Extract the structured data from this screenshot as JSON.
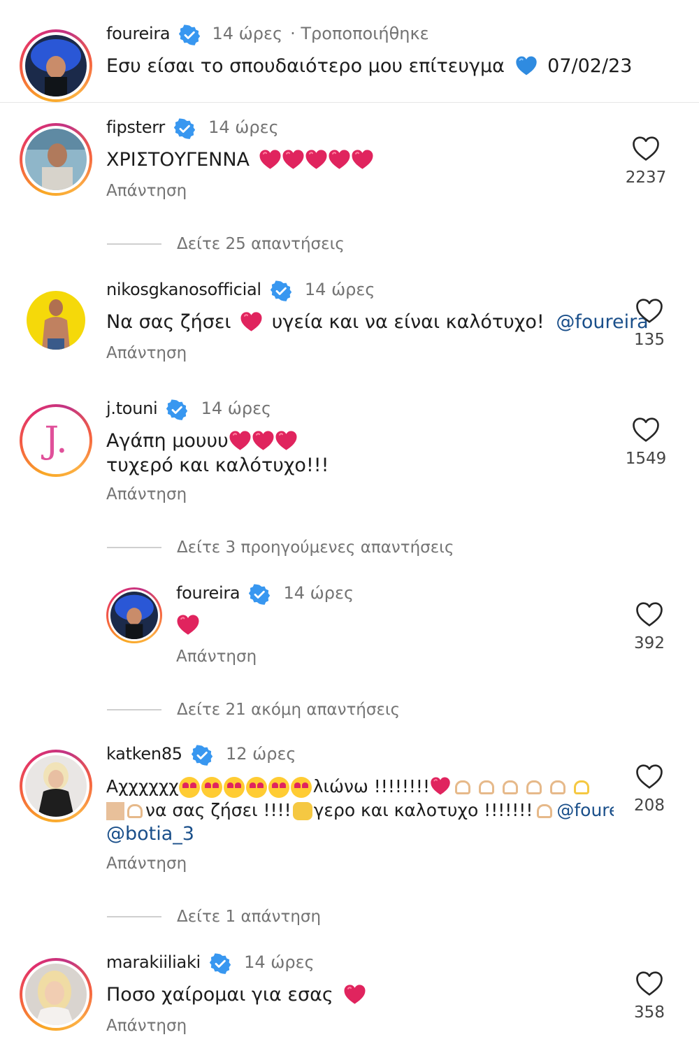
{
  "caption": {
    "username": "foureira",
    "time": "14 ώρες",
    "edited": "· Τροποποιήθηκε",
    "text": "Εσυ είσαι το σπουδαιότερο μου επίτευγμα",
    "date": "07/02/23"
  },
  "comments": [
    {
      "username": "fipsterr",
      "time": "14 ώρες",
      "text": "ΧΡΙΣΤΟΥΓΕΝΝΑ",
      "reply": "Απάντηση",
      "likes": "2237"
    },
    {
      "username": "nikosgkanosofficial",
      "time": "14 ώρες",
      "text_a": "Να σας ζήσει",
      "text_b": "υγεία και να είναι καλότυχο!",
      "mention": "@foureira",
      "reply": "Απάντηση",
      "likes": "135"
    },
    {
      "username": "j.touni",
      "time": "14 ώρες",
      "line1": "Αγάπη μουυυ",
      "line2": "τυχερό και καλότυχο!!!",
      "reply": "Απάντηση",
      "likes": "1549",
      "avatar_letter": "J."
    },
    {
      "username": "foureira",
      "time": "14 ώρες",
      "reply": "Απάντηση",
      "likes": "392"
    },
    {
      "username": "katken85",
      "time": "12 ώρες",
      "line1_a": "Αχχχχχχ",
      "line1_b": "λιώνω !!!!!!!!",
      "line2_a": "να σας ζήσει !!!!",
      "line2_b": "γερο και καλοτυχο !!!!!!!",
      "mention1": "@foureii",
      "mention2": "@botia_3",
      "reply": "Απάντηση",
      "likes": "208"
    },
    {
      "username": "marakiiliaki",
      "time": "14 ώρες",
      "text": "Ποσο χαίρομαι για εσας",
      "reply": "Απάντηση",
      "likes": "358"
    }
  ],
  "view_more": [
    "Δείτε 25 απαντήσεις",
    "Δείτε 3 προηγούμενες απαντήσεις",
    "Δείτε 21 ακόμη απαντήσεις",
    "Δείτε 1 απάντηση"
  ],
  "colors": {
    "accent_blue": "#1a4f8a",
    "verified_blue": "#3897f0",
    "heart_red": "#e0245e",
    "muted": "#737373"
  },
  "icons": [
    "verified-badge-icon",
    "heart-outline-icon",
    "red-heart-emoji",
    "blue-heart-emoji"
  ]
}
